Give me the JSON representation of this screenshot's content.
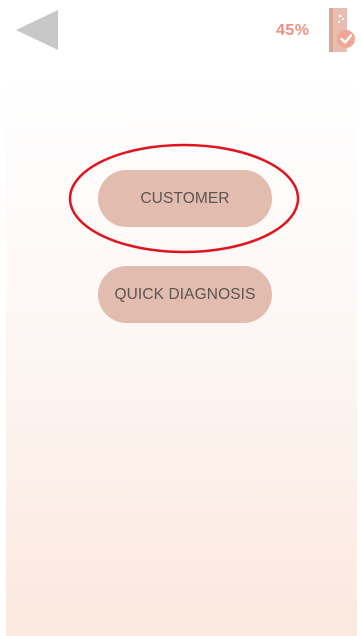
{
  "header": {
    "back_icon": "back-triangle-icon",
    "progress_label": "45%",
    "product_icon": "product-checkmark-icon"
  },
  "main": {
    "buttons": [
      {
        "label": "CUSTOMER",
        "highlighted": true
      },
      {
        "label": "QUICK DIAGNOSIS",
        "highlighted": false
      }
    ]
  },
  "colors": {
    "accent": "#ee8f82",
    "button_bg": "#e2bcae",
    "button_text": "#5e5450",
    "back_icon": "#c8c8c8",
    "highlight": "#e0141e"
  }
}
